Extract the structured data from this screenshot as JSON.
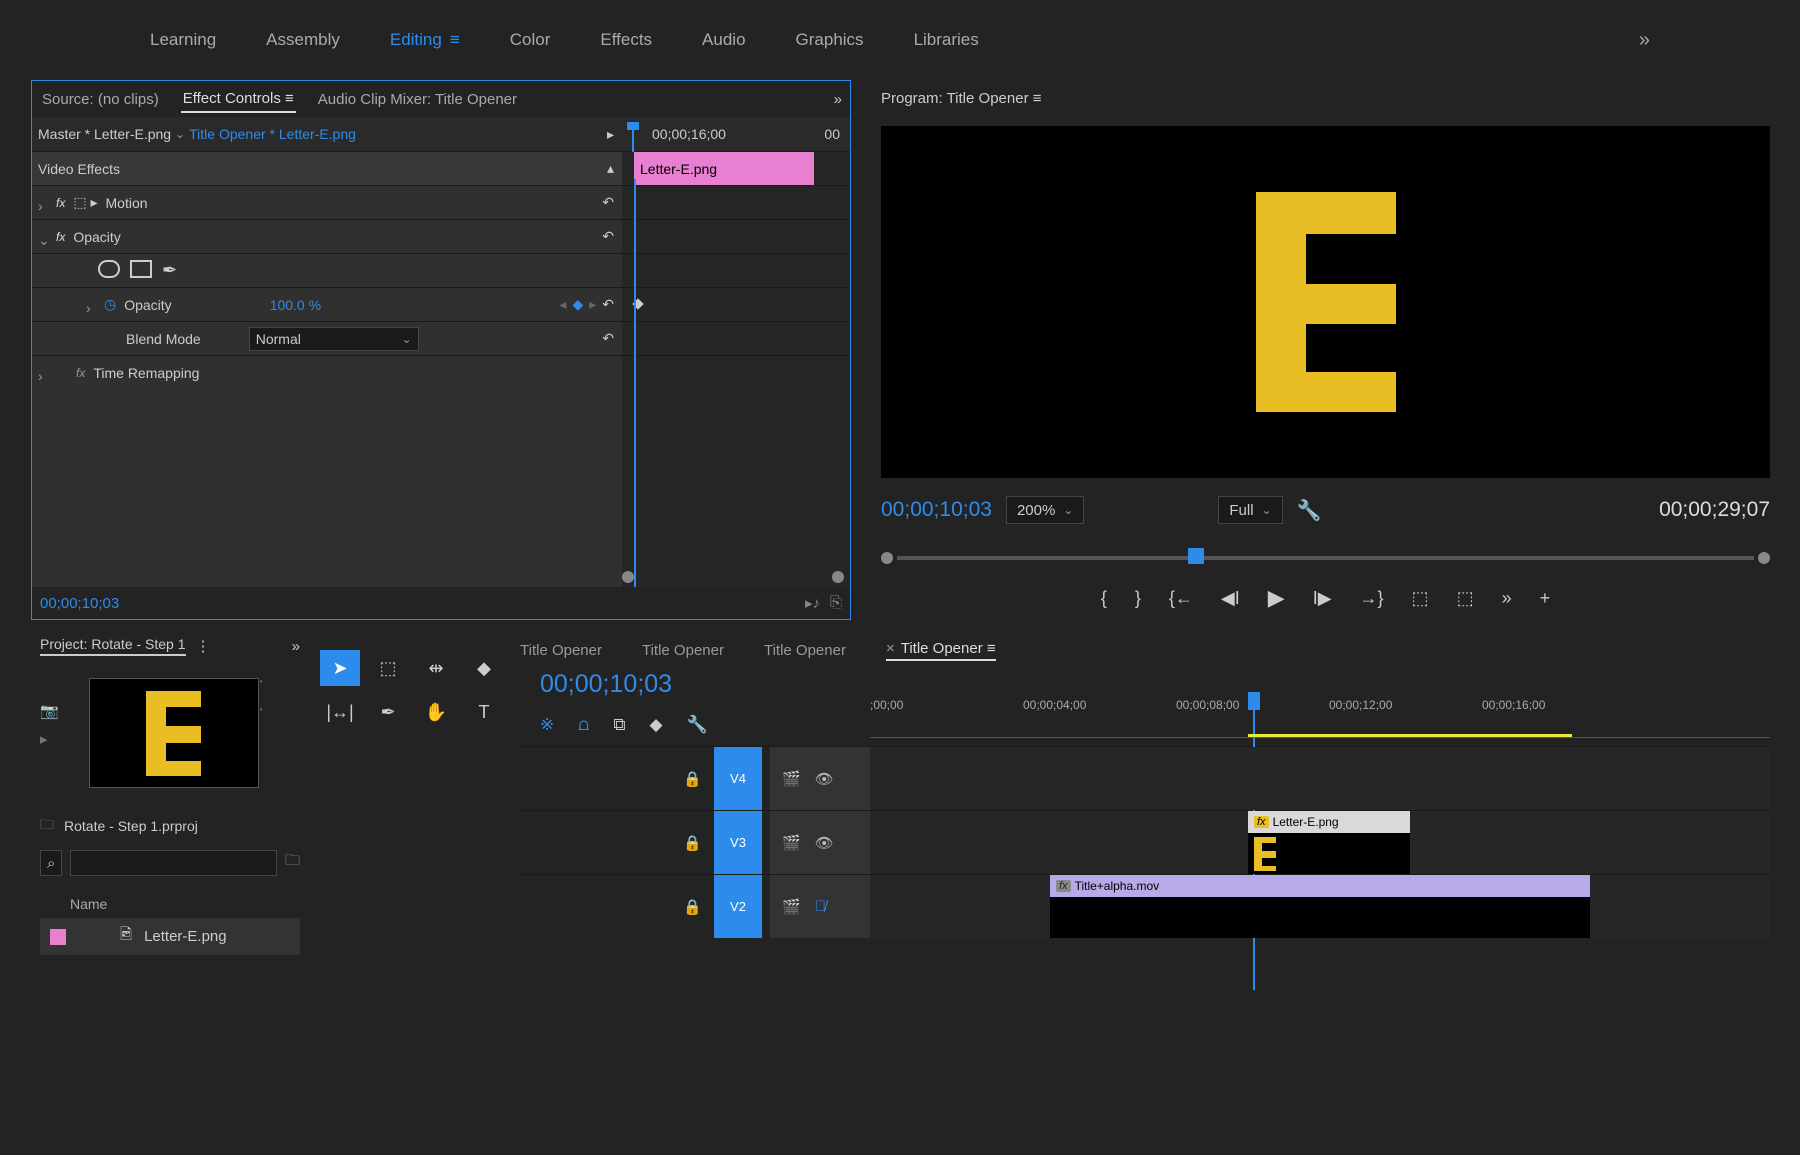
{
  "workspace": {
    "tabs": [
      "Learning",
      "Assembly",
      "Editing",
      "Color",
      "Effects",
      "Audio",
      "Graphics",
      "Libraries"
    ],
    "active": "Editing"
  },
  "effectControls": {
    "tabs": {
      "source": "Source: (no clips)",
      "effectControls": "Effect Controls",
      "audioMixer": "Audio Clip Mixer: Title Opener"
    },
    "master": "Master * Letter-E.png",
    "source": "Title Opener * Letter-E.png",
    "timelineLabel": "00;00;16;00",
    "timelineEnd": "00",
    "clipName": "Letter-E.png",
    "rows": {
      "videoEffects": "Video Effects",
      "motion": "Motion",
      "opacity": "Opacity",
      "opacityProp": "Opacity",
      "opacityValue": "100.0 %",
      "blendMode": "Blend Mode",
      "blendValue": "Normal",
      "timeRemap": "Time Remapping"
    },
    "currentTime": "00;00;10;03"
  },
  "program": {
    "title": "Program: Title Opener",
    "currentTime": "00;00;10;03",
    "zoom": "200%",
    "quality": "Full",
    "duration": "00;00;29;07"
  },
  "project": {
    "tab": "Project: Rotate - Step 1",
    "filename": "Rotate - Step 1.prproj",
    "nameHeader": "Name",
    "item": "Letter-E.png",
    "searchPlaceholder": ""
  },
  "timeline": {
    "tabs": [
      "Title Opener",
      "Title Opener",
      "Title Opener",
      "Title Opener"
    ],
    "activeIndex": 3,
    "currentTime": "00;00;10;03",
    "ruler": [
      ";00;00",
      "00;00;04;00",
      "00;00;08;00",
      "00;00;12;00",
      "00;00;16;00"
    ],
    "tracks": {
      "v4": "V4",
      "v3": "V3",
      "v2": "V2"
    },
    "clips": {
      "letter": "Letter-E.png",
      "alpha": "Title+alpha.mov"
    }
  }
}
